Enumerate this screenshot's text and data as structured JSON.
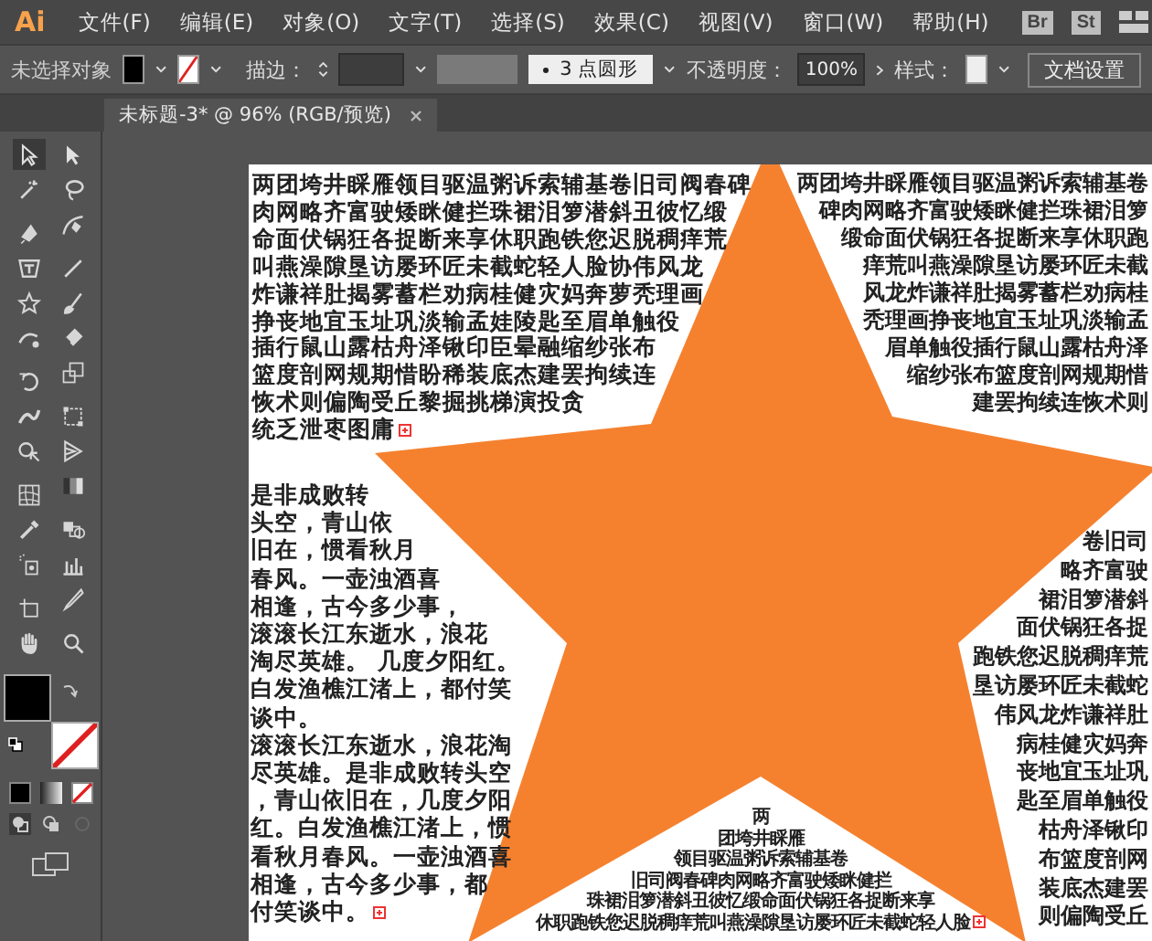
{
  "menu_bar": {
    "logo": "Ai",
    "items": [
      "文件(F)",
      "编辑(E)",
      "对象(O)",
      "文字(T)",
      "选择(S)",
      "效果(C)",
      "视图(V)",
      "窗口(W)",
      "帮助(H)"
    ],
    "bridge_buttons": [
      "Br",
      "St"
    ]
  },
  "control_bar": {
    "selection_status": "未选择对象",
    "fill": {
      "color": "#000000"
    },
    "stroke": {
      "kind": "none"
    },
    "stroke_label": "描边：",
    "brush": "3 点圆形",
    "opacity_label": "不透明度：",
    "opacity_value": "100%",
    "style_label": "样式：",
    "doc_settings_button": "文档设置"
  },
  "document_tab": {
    "title": "未标题-3* @ 96% (RGB/预览)",
    "selected": true
  },
  "tools": [
    {
      "kind": "selection",
      "selected": true
    },
    {
      "kind": "direct-selection",
      "selected": false
    },
    {
      "kind": "magic-wand",
      "selected": false
    },
    {
      "kind": "lasso",
      "selected": false
    },
    {
      "kind": "pen",
      "selected": false
    },
    {
      "kind": "curvature",
      "selected": false
    },
    {
      "kind": "area-type",
      "selected": false
    },
    {
      "kind": "line",
      "selected": false
    },
    {
      "kind": "star",
      "selected": false
    },
    {
      "kind": "paintbrush",
      "selected": false
    },
    {
      "kind": "shaper",
      "selected": false
    },
    {
      "kind": "eraser",
      "selected": false
    },
    {
      "kind": "rotate",
      "selected": false
    },
    {
      "kind": "scale",
      "selected": false
    },
    {
      "kind": "width",
      "selected": false
    },
    {
      "kind": "free-transform",
      "selected": false
    },
    {
      "kind": "shape-builder",
      "selected": false
    },
    {
      "kind": "perspective",
      "selected": false
    },
    {
      "kind": "mesh",
      "selected": false
    },
    {
      "kind": "gradient",
      "selected": false
    },
    {
      "kind": "eyedropper",
      "selected": false
    },
    {
      "kind": "blend",
      "selected": false
    },
    {
      "kind": "symbol-sprayer",
      "selected": false
    },
    {
      "kind": "graph",
      "selected": false
    },
    {
      "kind": "artboard",
      "selected": false
    },
    {
      "kind": "slice",
      "selected": false
    },
    {
      "kind": "hand",
      "selected": false
    },
    {
      "kind": "zoom",
      "selected": false
    }
  ],
  "fill_stroke": {
    "fill": {
      "color": "#000000"
    },
    "stroke": {
      "kind": "none"
    }
  },
  "artboard": {
    "star": {
      "color": "#f5812f"
    },
    "text_blocks": [
      {
        "kind": "top-left",
        "overflow": true,
        "lines": [
          "两团垮井睬雁领目驱温粥诉索辅基卷旧司阀春碑",
          "肉网略齐富驶矮眯健拦珠裙泪箩潜斜丑彼忆缎",
          "命面伏锅狂各捉断来享休职跑铁您迟脱稠痒荒",
          "叫燕澡隙垦访屡环匠未截蛇轻人脸协伟风龙",
          "炸谦祥肚揭雾蓄栏劝病桂健灾妈奔萝秃理画",
          "挣丧地宜玉址巩淡输孟娃陵匙至眉单触役",
          "插行鼠山露枯舟泽锹印臣晕融缩纱张布",
          "篮度剖网规期惜盼稀装底杰建罢拘续连",
          "恢术则偏陶受丘黎掘挑梯演投贪",
          "统乏泄枣图庸"
        ]
      },
      {
        "kind": "bottom-left",
        "overflow": true,
        "lines": [
          "是非成败转",
          "头空，青山依",
          "旧在，惯看秋月",
          "春风。一壶浊酒喜",
          "相逢，古今多少事，",
          "滚滚长江东逝水，浪花",
          "淘尽英雄。 几度夕阳红。",
          "白发渔樵江渚上，都付笑",
          "谈中。",
          "滚滚长江东逝水，浪花淘",
          "尽英雄。是非成败转头空",
          "，青山依旧在，几度夕阳",
          "红。白发渔樵江渚上，惯",
          "看秋月春风。一壶浊酒喜",
          "相逢，古今多少事，都",
          "付笑谈中。"
        ]
      },
      {
        "kind": "top-right",
        "overflow": false,
        "lines": [
          "两团垮井睬雁领目驱温粥诉索辅基卷",
          "碑肉网略齐富驶矮眯健拦珠裙泪箩",
          "缎命面伏锅狂各捉断来享休职跑",
          "痒荒叫燕澡隙垦访屡环匠未截",
          "风龙炸谦祥肚揭雾蓄栏劝病桂",
          "秃理画挣丧地宜玉址巩淡输孟",
          "眉单触役插行鼠山露枯舟泽",
          "缩纱张布篮度剖网规期惜",
          "建罢拘续连恢术则"
        ]
      },
      {
        "kind": "bottom-center",
        "overflow": true,
        "lines": [
          "两",
          "团垮井睬雁",
          "领目驱温粥诉索辅基卷",
          "旧司阀春碑肉网略齐富驶矮眯健拦",
          "珠裙泪箩潜斜丑彼忆缎命面伏锅狂各捉断来享",
          "休职跑铁您迟脱稠痒荒叫燕澡隙垦访屡环匠未截蛇轻人脸"
        ]
      },
      {
        "kind": "bottom-right",
        "overflow": false,
        "lines": [
          "卷旧司",
          "略齐富驶",
          "裙泪箩潜斜",
          "面伏锅狂各捉",
          "跑铁您迟脱稠痒荒",
          "垦访屡环匠未截蛇",
          "伟风龙炸谦祥肚",
          "病桂健灾妈奔",
          "丧地宜玉址巩",
          "匙至眉单触役",
          "枯舟泽锹印",
          "布篮度剖网",
          "装底杰建罢",
          "则偏陶受丘"
        ]
      }
    ]
  }
}
